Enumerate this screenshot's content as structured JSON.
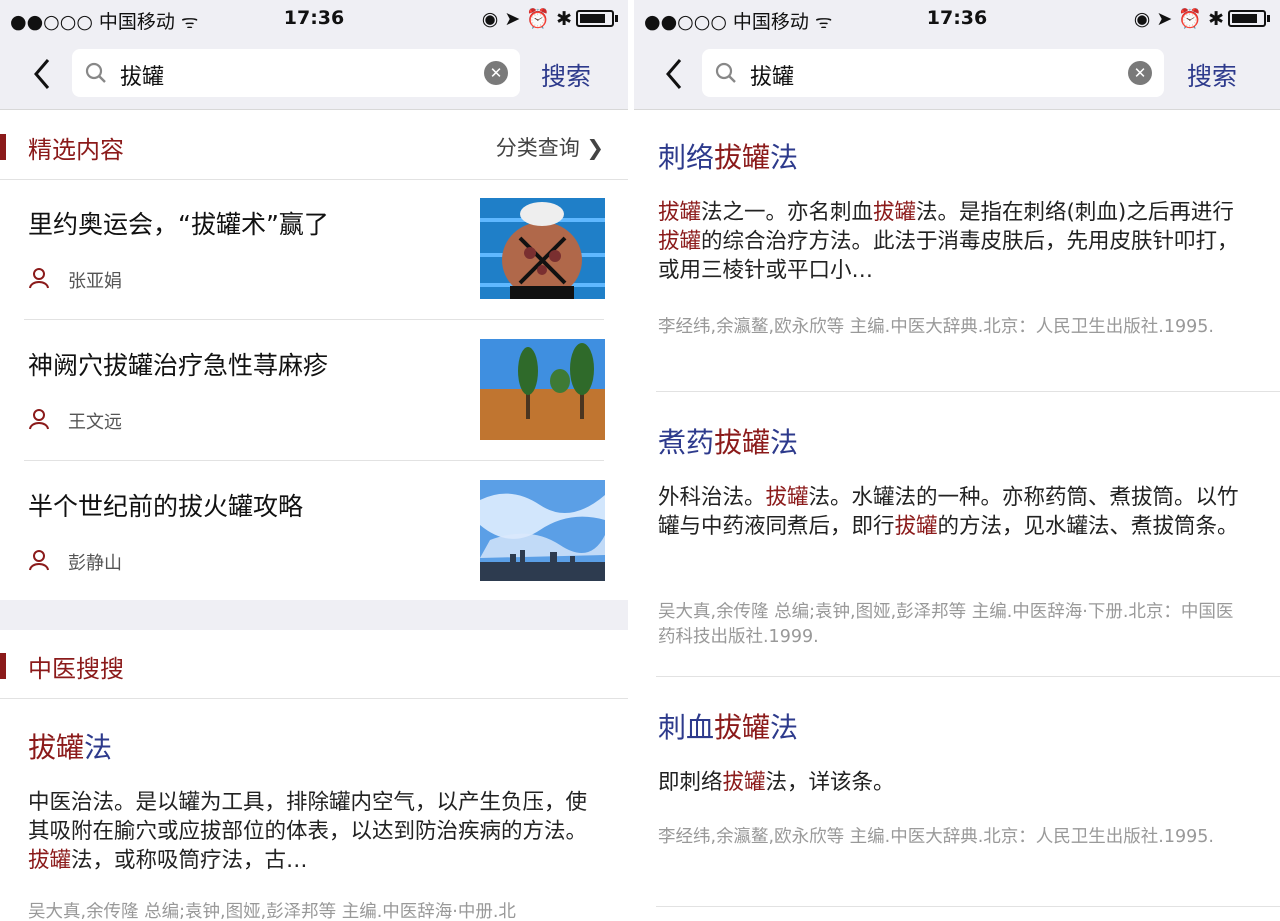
{
  "statusbar": {
    "carrier": "●●○○○ 中国移动 ᯤ",
    "time": "17:36",
    "icons": "◉ ➤ ⏰ ✱"
  },
  "search": {
    "query": "拔罐",
    "button_label": "搜索"
  },
  "left": {
    "featured": {
      "title": "精选内容",
      "more_label": "分类查询 ❯"
    },
    "articles": [
      {
        "title": "里约奥运会，“拔罐术”赢了",
        "author": "张亚娟",
        "image": "swimmer-photo"
      },
      {
        "title": "神阙穴拔罐治疗急性荨麻疹",
        "author": "王文远",
        "image": "trees-field-photo"
      },
      {
        "title": "半个世纪前的拔火罐攻略",
        "author": "彭静山",
        "image": "sky-city-photo"
      }
    ],
    "tcm_search": {
      "title": "中医搜搜"
    },
    "entry": {
      "title_hl": "拔罐",
      "title_rest": "法",
      "body_1": "中医治法。是以罐为工具，排除罐内空气，以产生负压，使其吸附在腧穴或应拔部位的体表，以达到防治疾病的方法。",
      "body_hl": "拔罐",
      "body_2": "法，或称吸筒疗法，古…",
      "source": "吴大真,余传隆 总编;袁钟,图娅,彭泽邦等 主编.中医辞海·中册.北"
    }
  },
  "right": {
    "entries": [
      {
        "title_pre": "刺络",
        "title_hl": "拔罐",
        "title_post": "法",
        "body": [
          {
            "t": "拔罐",
            "h": true
          },
          {
            "t": "法之一。亦名刺血",
            "h": false
          },
          {
            "t": "拔罐",
            "h": true
          },
          {
            "t": "法。是指在刺络(刺血)之后再进行",
            "h": false
          },
          {
            "t": "拔罐",
            "h": true
          },
          {
            "t": "的综合治疗方法。此法于消毒皮肤后，先用皮肤针叩打，或用三棱针或平口小…",
            "h": false
          }
        ],
        "source": "李经纬,余瀛鳌,欧永欣等 主编.中医大辞典.北京：人民卫生出版社.1995."
      },
      {
        "title_pre": "煮药",
        "title_hl": "拔罐",
        "title_post": "法",
        "body": [
          {
            "t": "外科治法。",
            "h": false
          },
          {
            "t": "拔罐",
            "h": true
          },
          {
            "t": "法。水罐法的一种。亦称药筒、煮拔筒。以竹罐与中药液同煮后，即行",
            "h": false
          },
          {
            "t": "拔罐",
            "h": true
          },
          {
            "t": "的方法，见水罐法、煮拔筒条。",
            "h": false
          }
        ],
        "source": "吴大真,余传隆 总编;袁钟,图娅,彭泽邦等 主编.中医辞海·下册.北京：中国医药科技出版社.1999."
      },
      {
        "title_pre": "刺血",
        "title_hl": "拔罐",
        "title_post": "法",
        "body": [
          {
            "t": "即刺络",
            "h": false
          },
          {
            "t": "拔罐",
            "h": true
          },
          {
            "t": "法，详该条。",
            "h": false
          }
        ],
        "source": "李经纬,余瀛鳌,欧永欣等 主编.中医大辞典.北京：人民卫生出版社.1995."
      }
    ]
  },
  "colors": {
    "accent_red": "#8b1a1a",
    "title_blue": "#2d3a8c",
    "bar_gray": "#efeff4"
  }
}
